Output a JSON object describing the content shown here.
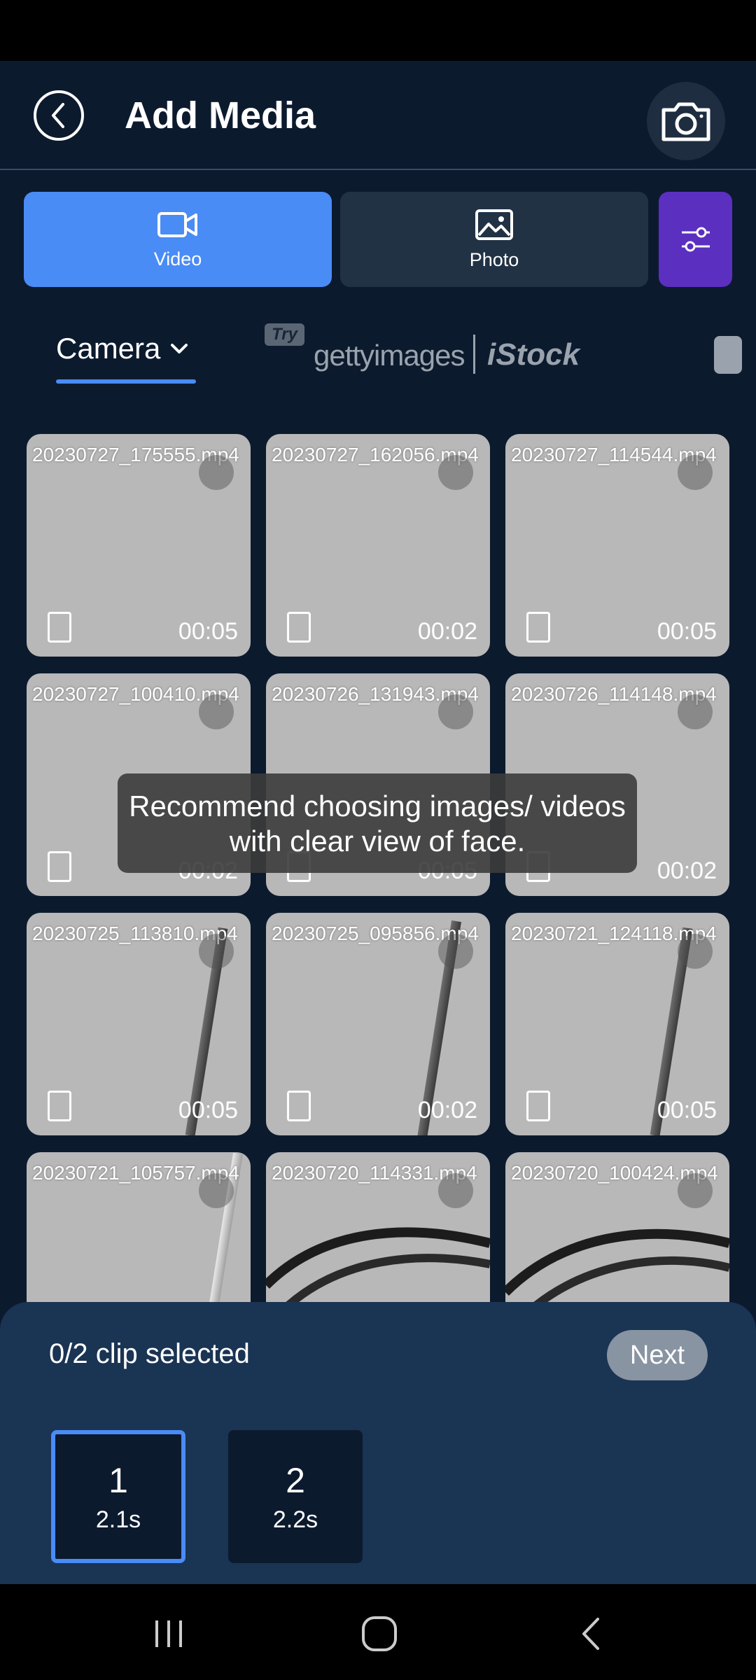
{
  "header": {
    "title": "Add Media"
  },
  "tabs": [
    {
      "label": "Video",
      "icon": "video-icon",
      "active": true
    },
    {
      "label": "Photo",
      "icon": "image-icon",
      "active": false
    }
  ],
  "sources": {
    "camera_label": "Camera",
    "try_badge": "Try",
    "getty_label": "gettyimages",
    "istock_label": "iStock"
  },
  "media": [
    {
      "name": "20230727_175555.mp4",
      "duration": "00:05"
    },
    {
      "name": "20230727_162056.mp4",
      "duration": "00:02"
    },
    {
      "name": "20230727_114544.mp4",
      "duration": "00:05"
    },
    {
      "name": "20230727_100410.mp4",
      "duration": "00:02"
    },
    {
      "name": "20230726_131943.mp4",
      "duration": "00:05"
    },
    {
      "name": "20230726_114148.mp4",
      "duration": "00:02"
    },
    {
      "name": "20230725_113810.mp4",
      "duration": "00:05"
    },
    {
      "name": "20230725_095856.mp4",
      "duration": "00:02"
    },
    {
      "name": "20230721_124118.mp4",
      "duration": "00:05"
    },
    {
      "name": "20230721_105757.mp4",
      "duration": ""
    },
    {
      "name": "20230720_114331.mp4",
      "duration": ""
    },
    {
      "name": "20230720_100424.mp4",
      "duration": ""
    }
  ],
  "toast": "Recommend choosing images/ videos with clear view of face.",
  "selection": {
    "status": "0/2 clip selected",
    "next_label": "Next",
    "slots": [
      {
        "number": "1",
        "duration": "2.1s",
        "active": true
      },
      {
        "number": "2",
        "duration": "2.2s",
        "active": false
      }
    ]
  },
  "colors": {
    "accent": "#4a8cf6",
    "filter": "#5b2fc0",
    "background": "#0c1a2e",
    "panel": "#1a3453"
  }
}
